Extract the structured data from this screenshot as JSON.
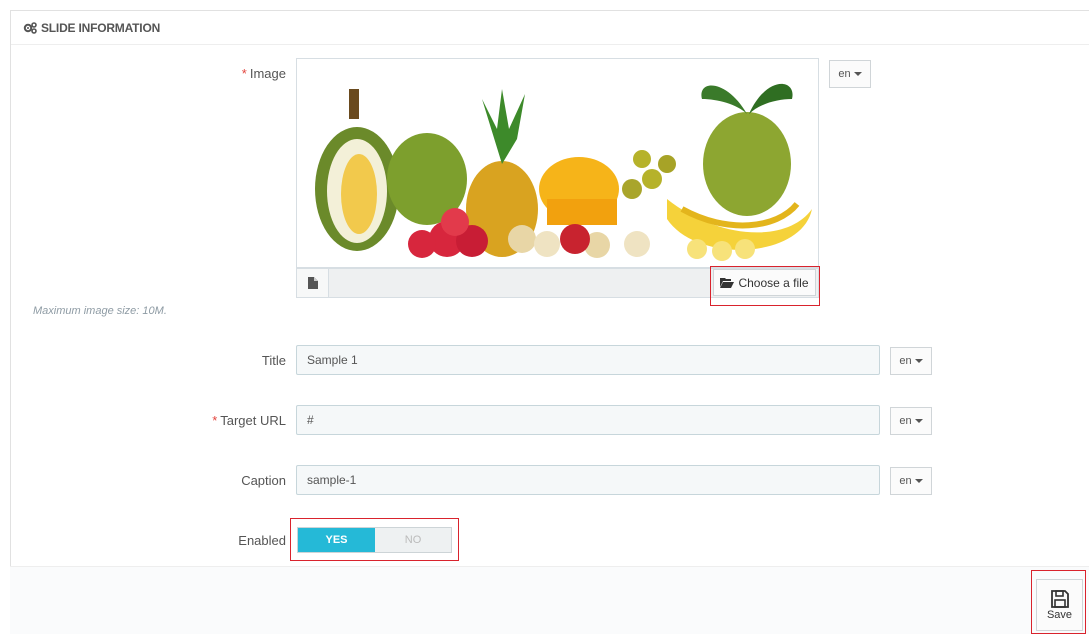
{
  "panel": {
    "title": "SLIDE INFORMATION"
  },
  "image_field": {
    "required_mark": "*",
    "label": "Image",
    "choose_label": "Choose a file",
    "hint": "Maximum image size: 10M.",
    "lang": "en"
  },
  "title_field": {
    "label": "Title",
    "value": "Sample 1",
    "lang": "en"
  },
  "url_field": {
    "required_mark": "*",
    "label": "Target URL",
    "value": "#",
    "lang": "en"
  },
  "caption_field": {
    "label": "Caption",
    "value": "sample-1",
    "lang": "en"
  },
  "enabled_field": {
    "label": "Enabled",
    "yes": "YES",
    "no": "NO",
    "selected": "YES"
  },
  "footer": {
    "save_label": "Save"
  },
  "icons": {
    "panel": "cogs-icon",
    "file": "file-icon",
    "folder": "folder-open-icon",
    "save": "floppy-disk-icon"
  },
  "colors": {
    "accent": "#25b9d7",
    "required": "#e3443d",
    "highlight": "#d9232d"
  }
}
